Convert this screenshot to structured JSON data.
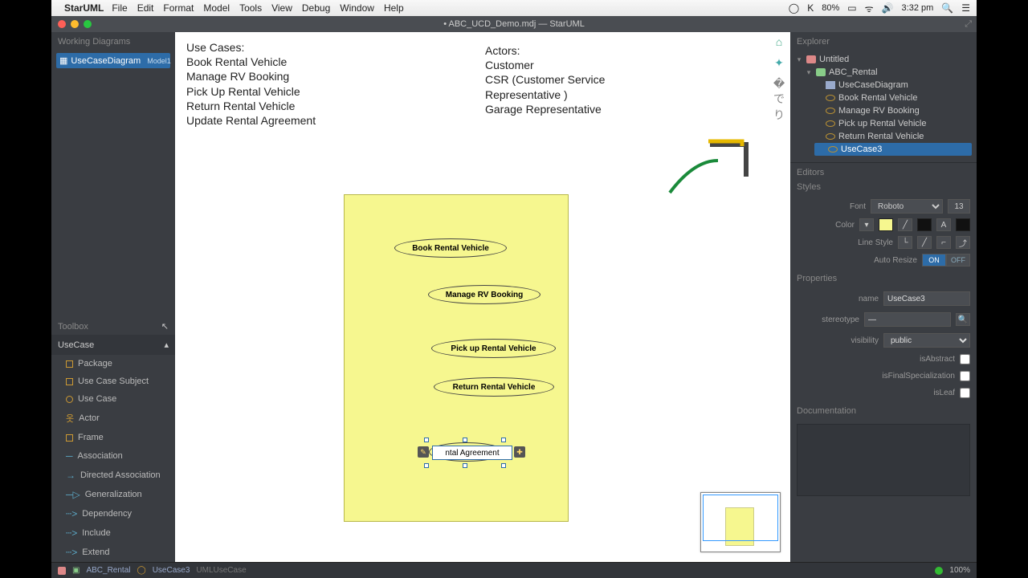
{
  "menubar": {
    "app": "StarUML",
    "items": [
      "File",
      "Edit",
      "Format",
      "Model",
      "Tools",
      "View",
      "Debug",
      "Window",
      "Help"
    ],
    "battery": "80%",
    "time": "3:32 pm"
  },
  "window_title": "• ABC_UCD_Demo.mdj — StarUML",
  "working_diagrams": {
    "title": "Working Diagrams",
    "item": "UseCaseDiagram",
    "tag": "Model1"
  },
  "toolbox": {
    "title": "Toolbox",
    "section": "UseCase",
    "items": [
      "Package",
      "Use Case Subject",
      "Use Case",
      "Actor",
      "Frame",
      "Association",
      "Directed Association",
      "Generalization",
      "Dependency",
      "Include",
      "Extend"
    ]
  },
  "canvas": {
    "use_cases_heading": "Use Cases:",
    "use_cases": [
      "Book Rental Vehicle",
      "Manage RV Booking",
      "Pick Up Rental Vehicle",
      "Return Rental Vehicle",
      "Update Rental Agreement"
    ],
    "actors_heading": "Actors:",
    "actors": [
      "Customer",
      "CSR (Customer Service",
      "Representative )",
      "Garage Representative"
    ],
    "uc_labels": {
      "uc1": "Book Rental Vehicle",
      "uc2": "Manage RV Booking",
      "uc3": "Pick up Rental Vehicle",
      "uc4": "Return Rental Vehicle",
      "editing": "ntal Agreement"
    }
  },
  "explorer": {
    "title": "Explorer",
    "root": "Untitled",
    "model": "ABC_Rental",
    "diagram": "UseCaseDiagram",
    "children": [
      "Book Rental Vehicle",
      "Manage RV Booking",
      "Pick up Rental Vehicle",
      "Return Rental Vehicle",
      "UseCase3"
    ]
  },
  "editors": {
    "title": "Editors",
    "styles_title": "Styles",
    "font_label": "Font",
    "font_value": "Roboto",
    "font_size": "13",
    "color_label": "Color",
    "linestyle_label": "Line Style",
    "autoresize_label": "Auto Resize",
    "autoresize_on": "ON",
    "autoresize_off": "OFF",
    "properties_title": "Properties",
    "name_label": "name",
    "name_value": "UseCase3",
    "stereotype_label": "stereotype",
    "stereotype_value": "—",
    "visibility_label": "visibility",
    "visibility_value": "public",
    "isAbstract_label": "isAbstract",
    "isFinal_label": "isFinalSpecialization",
    "isLeaf_label": "isLeaf",
    "documentation_title": "Documentation"
  },
  "statusbar": {
    "model": "ABC_Rental",
    "element": "UseCase3",
    "type": "UMLUseCase",
    "zoom": "100%"
  }
}
